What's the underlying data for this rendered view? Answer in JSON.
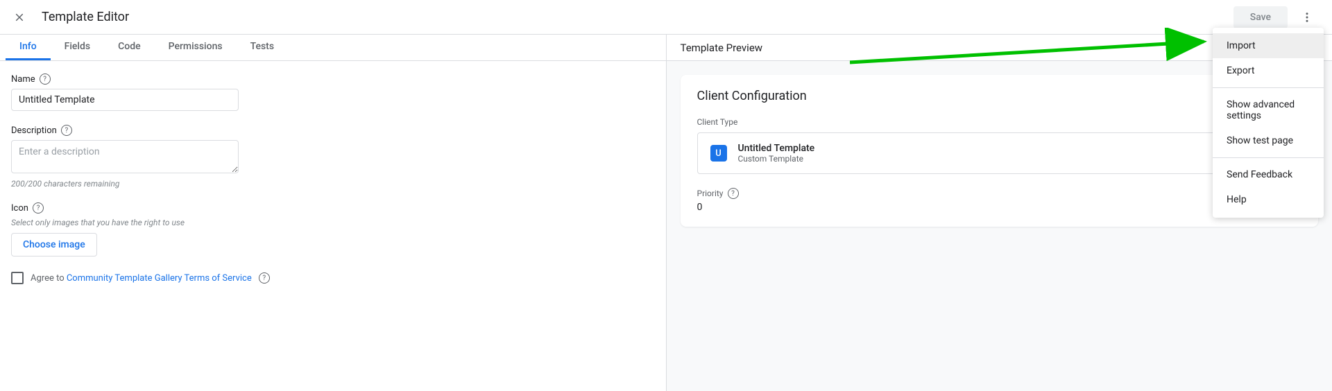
{
  "header": {
    "title": "Template Editor",
    "save_label": "Save"
  },
  "tabs": {
    "info": "Info",
    "fields": "Fields",
    "code": "Code",
    "permissions": "Permissions",
    "tests": "Tests"
  },
  "form": {
    "name_label": "Name",
    "name_value": "Untitled Template",
    "description_label": "Description",
    "description_placeholder": "Enter a description",
    "description_hint": "200/200 characters remaining",
    "icon_label": "Icon",
    "icon_hint": "Select only images that you have the right to use",
    "choose_image_label": "Choose image",
    "agree_prefix": "Agree to ",
    "agree_link": "Community Template Gallery Terms of Service"
  },
  "preview": {
    "title": "Template Preview",
    "card_title": "Client Configuration",
    "client_type_label": "Client Type",
    "client_icon_letter": "U",
    "client_name": "Untitled Template",
    "client_sub": "Custom Template",
    "priority_label": "Priority",
    "priority_value": "0"
  },
  "menu": {
    "import": "Import",
    "export": "Export",
    "show_advanced": "Show advanced settings",
    "show_test_page": "Show test page",
    "send_feedback": "Send Feedback",
    "help": "Help"
  }
}
